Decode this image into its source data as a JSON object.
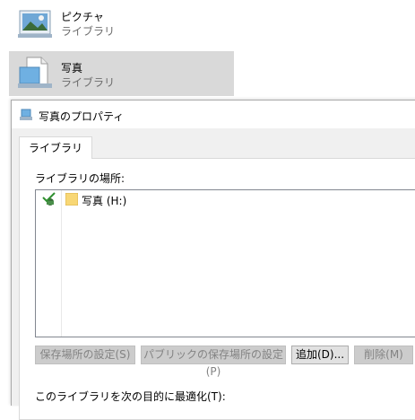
{
  "libraries": [
    {
      "name": "ピクチャ",
      "subtitle": "ライブラリ",
      "icon": "pictures-library-icon",
      "selected": false
    },
    {
      "name": "写真",
      "subtitle": "ライブラリ",
      "icon": "photos-library-icon",
      "selected": true
    }
  ],
  "dialog": {
    "title": "写真のプロパティ",
    "icon": "library-properties-icon",
    "tab": "ライブラリ",
    "location_label": "ライブラリの場所:",
    "locations": [
      {
        "name": "写真 (H:)",
        "default": true
      }
    ],
    "buttons": {
      "set_save_location": "保存場所の設定(S)",
      "set_public_save_location": "パブリックの保存場所の設定(P)",
      "add": "追加(D)...",
      "remove": "削除(M)"
    },
    "optimize_label": "このライブラリを次の目的に最適化(T):"
  },
  "colors": {
    "selected_item_bg": "#d9d9d9",
    "dialog_bg": "#f0f0f0",
    "folder_yellow": "#f8d775",
    "disabled_text": "#838383"
  }
}
